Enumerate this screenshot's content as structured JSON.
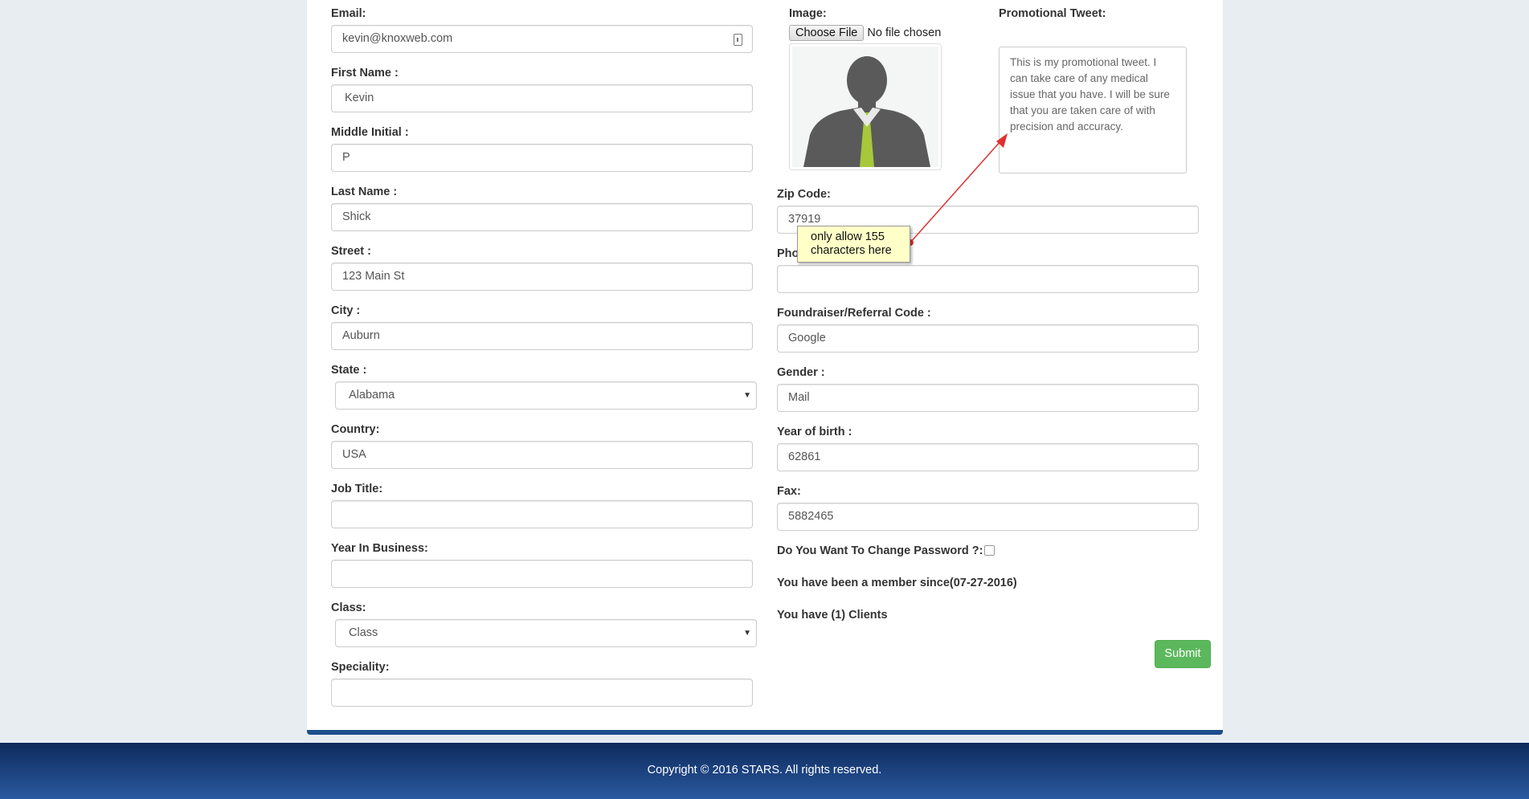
{
  "form": {
    "email": {
      "label": "Email:",
      "value": "kevin@knoxweb.com"
    },
    "first_name": {
      "label": "First Name :",
      "value": "Kevin"
    },
    "middle_initial": {
      "label": "Middle Initial :",
      "value": "P"
    },
    "last_name": {
      "label": "Last Name :",
      "value": "Shick"
    },
    "street": {
      "label": "Street :",
      "value": "123 Main St"
    },
    "city": {
      "label": "City :",
      "value": "Auburn"
    },
    "state": {
      "label": "State :",
      "value": "Alabama"
    },
    "country": {
      "label": "Country:",
      "value": "USA"
    },
    "job_title": {
      "label": "Job Title:",
      "value": ""
    },
    "year_in_business": {
      "label": "Year In Business:",
      "value": ""
    },
    "class": {
      "label": "Class:",
      "value": "Class"
    },
    "speciality": {
      "label": "Speciality:",
      "value": ""
    },
    "image": {
      "label": "Image:",
      "button": "Choose File",
      "status": "No file chosen"
    },
    "promo_tweet": {
      "label": "Promotional Tweet:",
      "value": "This is my promotional tweet. I can take care of any medical issue that you have. I will be sure that you are taken care of with precision and accuracy."
    },
    "zip": {
      "label": "Zip Code:",
      "value": "37919"
    },
    "phone": {
      "label": "Pho",
      "value": ""
    },
    "referral": {
      "label": "Foundraiser/Referral Code :",
      "value": "Google"
    },
    "gender": {
      "label": "Gender :",
      "value": "Mail"
    },
    "year_of_birth": {
      "label": "Year of birth :",
      "value": "62861"
    },
    "fax": {
      "label": "Fax:",
      "value": "5882465"
    },
    "change_password": {
      "label": "Do You Want To Change Password ?:",
      "checked": false
    },
    "member_since": "You have been a member since(07-27-2016)",
    "clients": "You have (1) Clients",
    "submit": "Submit"
  },
  "annotation": {
    "line1": "only allow 155",
    "line2": "characters here"
  },
  "footer": {
    "copyright": "Copyright © 2016 STARS. All rights reserved."
  },
  "colors": {
    "accent_submit": "#5cb85c",
    "footer_top": "#0e2a5c",
    "footer_bottom": "#2a5aa0",
    "card_border": "#1e4e8c"
  },
  "icons": [
    "caret-down-icon",
    "avatar-silhouette-icon",
    "contact-card-icon"
  ]
}
